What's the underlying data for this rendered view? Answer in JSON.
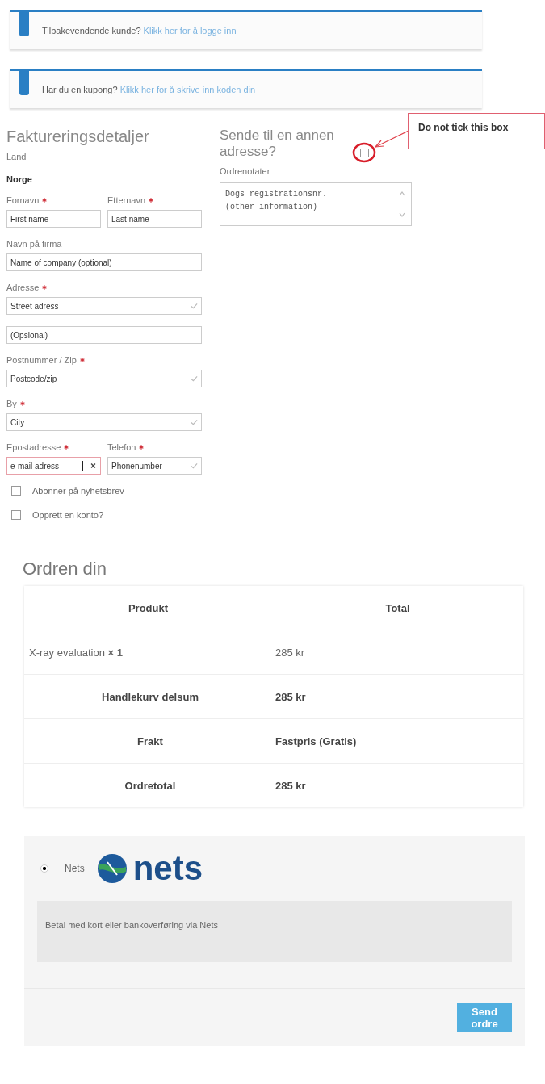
{
  "notices": [
    {
      "text": "Tilbakevendende kunde?",
      "link": "Klikk her for å logge inn"
    },
    {
      "text": "Har du en kupong?",
      "link": "Klikk her for å skrive inn koden din"
    }
  ],
  "billing": {
    "title": "Faktureringsdetaljer",
    "country_label": "Land",
    "country": "Norge",
    "rows": [
      [
        {
          "label": "Fornavn",
          "required": true,
          "value": "First name",
          "valid": false,
          "error": false
        },
        {
          "label": "Etternavn",
          "required": true,
          "value": "Last name",
          "valid": false,
          "error": false
        }
      ],
      [
        {
          "label": "Navn på firma",
          "required": false,
          "value": "Name of company (optional)",
          "valid": false,
          "error": false
        }
      ],
      [
        {
          "label": "Adresse",
          "required": true,
          "value": "Street adress",
          "valid": true,
          "error": false
        }
      ],
      [
        {
          "value": "(Opsional)",
          "valid": false,
          "error": false
        }
      ],
      [
        {
          "label": "Postnummer / Zip",
          "required": true,
          "value": "Postcode/zip",
          "valid": true,
          "error": false
        }
      ],
      [
        {
          "label": "By",
          "required": true,
          "value": "City",
          "valid": true,
          "error": false
        }
      ],
      [
        {
          "label": "Epostadresse",
          "required": true,
          "value": "e-mail adress",
          "valid": false,
          "error": true
        },
        {
          "label": "Telefon",
          "required": true,
          "value": "Phonenumber",
          "valid": true,
          "error": false
        }
      ]
    ],
    "checkboxes": [
      {
        "label": "Abonner på nyhetsbrev",
        "checked": false
      },
      {
        "label": "Opprett en konto?",
        "checked": false
      }
    ]
  },
  "shipping": {
    "title": "Sende til en annen adresse?",
    "checked": false,
    "notes_label": "Ordrenotater",
    "notes_lines": [
      "Dogs registrationsnr.",
      "(other information)"
    ]
  },
  "annotation": {
    "text": "Do not tick this box"
  },
  "order": {
    "title": "Ordren din",
    "columns": [
      "Produkt",
      "Total"
    ],
    "rows": [
      {
        "kind": "item",
        "label": "X-ray evaluation **× 1**",
        "total": "285 kr"
      },
      {
        "kind": "subtotal",
        "label": "Handlekurv delsum",
        "total": "285 kr"
      },
      {
        "kind": "shipping",
        "label": "Frakt",
        "total": "Fastpris (Gratis)"
      },
      {
        "kind": "total",
        "label": "Ordretotal",
        "total": "285 kr"
      }
    ]
  },
  "payment": {
    "methods": [
      {
        "label": "Nets",
        "selected": true,
        "logo": "nets",
        "description": "Betal med kort eller bankoverføring via Nets"
      }
    ],
    "button": "Send ordre"
  }
}
